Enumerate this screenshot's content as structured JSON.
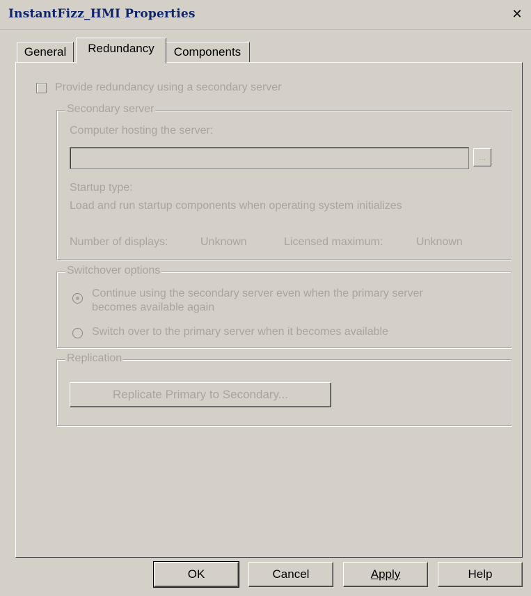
{
  "window": {
    "title": "InstantFizz_HMI Properties",
    "close_glyph": "✕"
  },
  "tabs": [
    {
      "label": "General"
    },
    {
      "label": "Redundancy"
    },
    {
      "label": "Components"
    }
  ],
  "redundancy": {
    "checkbox_label": "Provide redundancy using a secondary server",
    "checkbox_checked": false,
    "secondary_server": {
      "legend": "Secondary server",
      "host_label": "Computer hosting the server:",
      "host_value": "",
      "browse_label": "...",
      "startup_label": "Startup type:",
      "startup_value": "Load and run startup components when operating system initializes",
      "displays_label": "Number of displays:",
      "displays_value": "Unknown",
      "licensed_label": "Licensed maximum:",
      "licensed_value": "Unknown"
    },
    "switchover": {
      "legend": "Switchover options",
      "option1_line1": "Continue using the secondary server even when the primary server",
      "option1_line2": "becomes available again",
      "option2": "Switch over to the primary server when it becomes available",
      "selected": "option1"
    },
    "replication": {
      "legend": "Replication",
      "button_label": "Replicate Primary to Secondary..."
    }
  },
  "footer": {
    "ok": "OK",
    "cancel": "Cancel",
    "apply": "Apply",
    "help": "Help"
  }
}
